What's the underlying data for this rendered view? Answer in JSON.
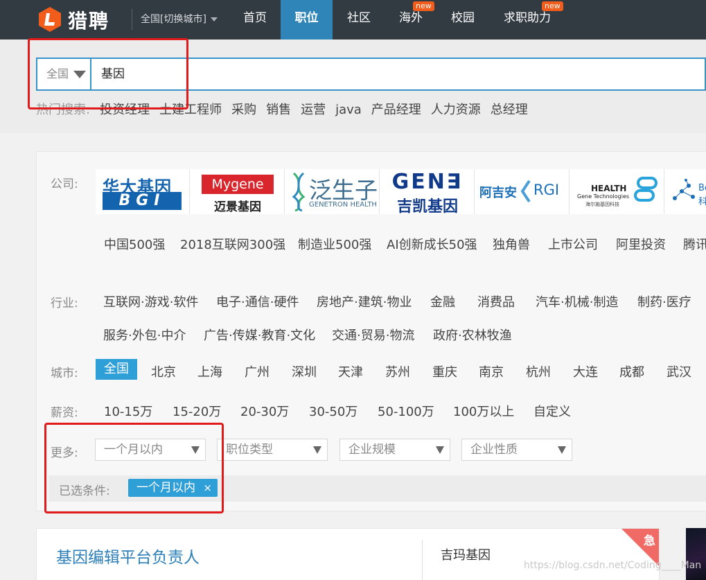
{
  "brand": {
    "logo_text": "猎聘"
  },
  "nav": {
    "city_switch": "全国[切换城市]",
    "items": [
      {
        "label": "首页",
        "active": false
      },
      {
        "label": "职位",
        "active": true
      },
      {
        "label": "社区",
        "active": false
      },
      {
        "label": "海外",
        "active": false,
        "badge": "new"
      },
      {
        "label": "校园",
        "active": false
      },
      {
        "label": "求职助力",
        "active": false,
        "badge": "new"
      }
    ]
  },
  "search": {
    "city": "全国",
    "query": "基因",
    "hot_label": "热门搜索:",
    "hot_items": [
      "投资经理",
      "土建工程师",
      "采购",
      "销售",
      "运营",
      "java",
      "产品经理",
      "人力资源",
      "总经理"
    ]
  },
  "filters": {
    "company_label": "公司:",
    "company_logos": [
      {
        "name": "华大基因 BGI",
        "line1": "华大基因",
        "line2": "BGI",
        "color": "#1463ae"
      },
      {
        "name": "Mygene 迈景基因",
        "line1": "Mygene",
        "line2": "迈景基因",
        "color": "#d8262c"
      },
      {
        "name": "泛生子 GENETRON HEALTH",
        "line1": "泛生子",
        "line2": "GENETRON HEALTH",
        "color": "#3d6e8f"
      },
      {
        "name": "GENE 吉凯基因",
        "line1": "GEN∃",
        "line2": "吉凯基因",
        "color": "#113b8a"
      },
      {
        "name": "阿吉安 RGI",
        "line1": "阿吉安",
        "line2": "RGI",
        "color": "#1b6fb8"
      },
      {
        "name": "HEALTH Gene Technologies 海尔施基因科技",
        "line1": "HEALTH",
        "line2": "Gene Technologies",
        "line3": "海尔施基因科技",
        "color": "#222222"
      },
      {
        "name": "partial logo",
        "line1": "Be",
        "line2": "科",
        "color": "#1b6fb8"
      }
    ],
    "company_types": [
      "中国500强",
      "2018互联网300强",
      "制造业500强",
      "AI创新成长50强",
      "独角兽",
      "上市公司",
      "阿里投资",
      "腾讯"
    ],
    "industry_label": "行业:",
    "industries_row1": [
      "互联网·游戏·软件",
      "电子·通信·硬件",
      "房地产·建筑·物业",
      "金融",
      "消费品",
      "汽车·机械·制造",
      "制药·医疗"
    ],
    "industries_row2": [
      "服务·外包·中介",
      "广告·传媒·教育·文化",
      "交通·贸易·物流",
      "政府·农林牧渔"
    ],
    "city_label": "城市:",
    "cities": [
      "全国",
      "北京",
      "上海",
      "广州",
      "深圳",
      "天津",
      "苏州",
      "重庆",
      "南京",
      "杭州",
      "大连",
      "成都",
      "武汉"
    ],
    "selected_city": "全国",
    "salary_label": "薪资:",
    "salaries": [
      "10-15万",
      "15-20万",
      "20-30万",
      "30-50万",
      "50-100万",
      "100万以上",
      "自定义"
    ],
    "more_label": "更多:",
    "dropdowns": [
      "一个月以内",
      "职位类型",
      "企业规模",
      "企业性质"
    ],
    "chosen_label": "已选条件:",
    "chosen_tag": "一个月以内",
    "chosen_remove": "×"
  },
  "job": {
    "title": "基因编辑平台负责人",
    "company": "吉玛基因",
    "urgent": "急"
  },
  "watermark": "https://blog.csdn.net/Coding____Man",
  "colors": {
    "accent": "#2f9fd8",
    "nav_bg": "#323a42",
    "annotation": "#e11b1b",
    "brand_orange": "#f35d1b"
  }
}
